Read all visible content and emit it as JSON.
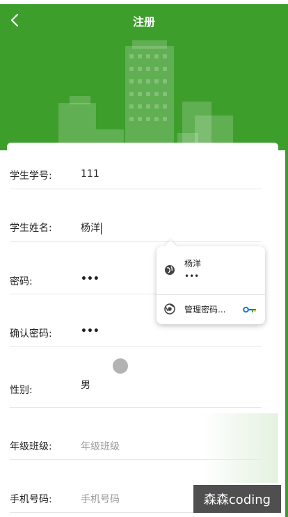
{
  "header": {
    "title": "注册",
    "back_icon": "chevron-left-icon",
    "bg_color": "#3d9e2c"
  },
  "form": {
    "student_id": {
      "label": "学生学号:",
      "value": "111"
    },
    "student_name": {
      "label": "学生姓名:",
      "value": "杨洋"
    },
    "password": {
      "label": "密码:",
      "value": "•••"
    },
    "confirm_password": {
      "label": "确认密码:",
      "value": "•••"
    },
    "gender": {
      "label": "性别:",
      "value": "男"
    },
    "grade_class": {
      "label": "年级班级:",
      "placeholder": "年级班级"
    },
    "phone": {
      "label": "手机号码:",
      "placeholder": "手机号码"
    }
  },
  "autofill": {
    "suggestion_name": "杨洋",
    "suggestion_password": "•••",
    "manage_label": "管理密码..."
  },
  "watermark": "森森coding"
}
